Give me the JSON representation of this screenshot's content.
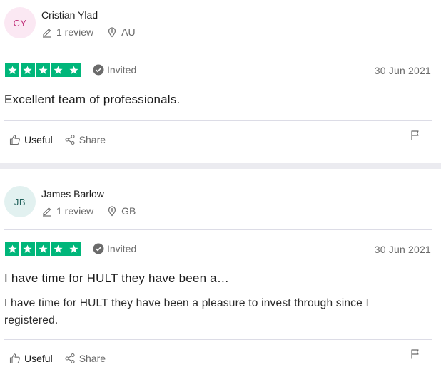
{
  "reviews": [
    {
      "initials": "CY",
      "avatar_bg": "#fbe8f3",
      "avatar_fg": "#c0307a",
      "name": "Cristian Ylad",
      "review_count": "1 review",
      "country": "AU",
      "rating": 5,
      "invited_label": "Invited",
      "date": "30 Jun 2021",
      "title": "Excellent team of professionals.",
      "body": "",
      "useful_label": "Useful",
      "share_label": "Share"
    },
    {
      "initials": "JB",
      "avatar_bg": "#e2f1f0",
      "avatar_fg": "#20605a",
      "name": "James Barlow",
      "review_count": "1 review",
      "country": "GB",
      "rating": 5,
      "invited_label": "Invited",
      "date": "30 Jun 2021",
      "title": "I have time for HULT they have been a…",
      "body": "I have time for HULT they have been a pleasure to invest through since I registered.",
      "useful_label": "Useful",
      "share_label": "Share"
    }
  ],
  "colors": {
    "star_green": "#00b67a",
    "muted_text": "#6b6b6b",
    "divider": "#dcdce6"
  }
}
